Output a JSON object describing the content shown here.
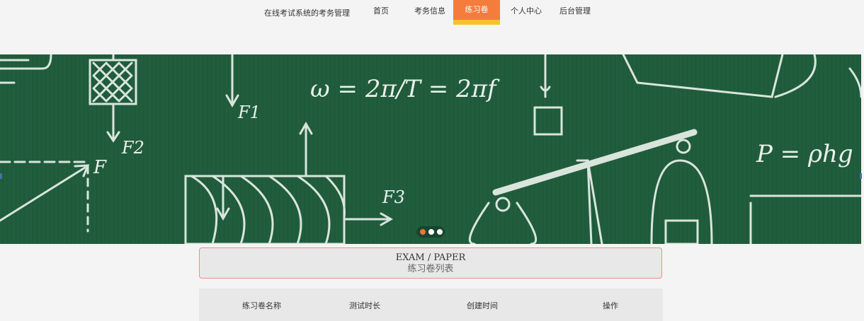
{
  "nav": {
    "site_title": "在线考试系统的考务管理",
    "items": [
      {
        "label": "首页"
      },
      {
        "label": "考务信息"
      },
      {
        "label": "练习卷"
      },
      {
        "label": "个人中心"
      },
      {
        "label": "后台管理"
      }
    ],
    "active_index": 2
  },
  "banner": {
    "formulas": {
      "omega": "ω = 2π/T = 2πf",
      "pressure": "P = ρhg",
      "f1": "F1",
      "f2": "F2",
      "f3": "F3",
      "f": "F"
    },
    "carousel": {
      "count": 3,
      "active_index": 0
    }
  },
  "section": {
    "title_en": "EXAM / PAPER",
    "title_cn": "练习卷列表"
  },
  "table": {
    "columns": [
      "练习卷名称",
      "测试时长",
      "创建时间",
      "操作"
    ]
  },
  "colors": {
    "accent": "#f47c3c",
    "accent_underline": "#f6c428",
    "board": "#1f5a3b",
    "border": "#ef8e83"
  }
}
